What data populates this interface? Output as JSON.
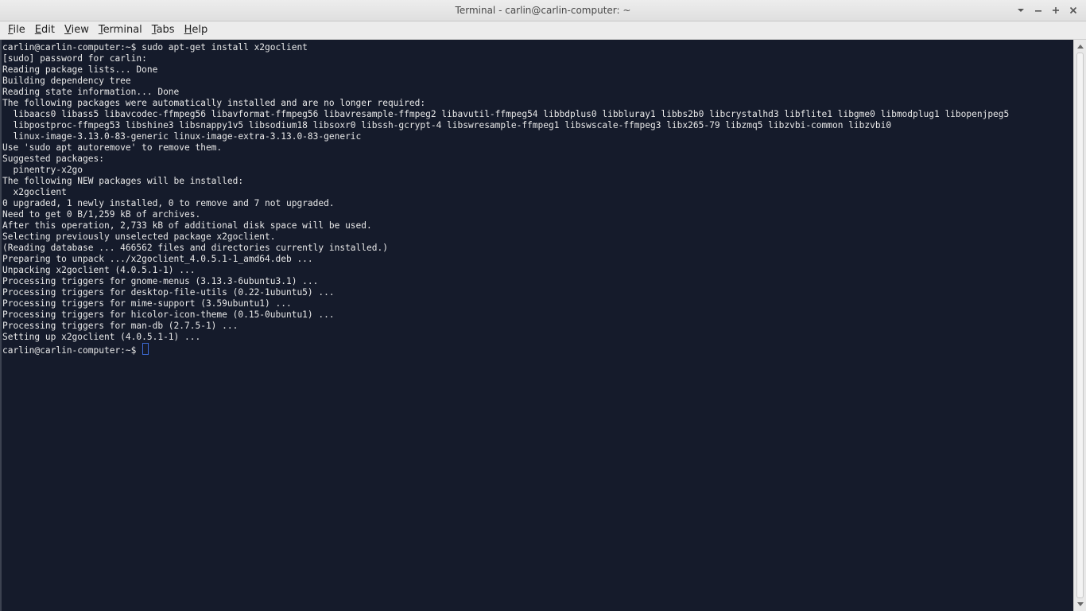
{
  "window": {
    "title": "Terminal - carlin@carlin-computer: ~"
  },
  "controls": {
    "menu_icon": "chevron-down-icon",
    "minimize_icon": "minimize-icon",
    "maximize_icon": "maximize-icon",
    "close_icon": "close-icon"
  },
  "menu": [
    {
      "label": "File",
      "mnemonic": "F",
      "rest": "ile"
    },
    {
      "label": "Edit",
      "mnemonic": "E",
      "rest": "dit"
    },
    {
      "label": "View",
      "mnemonic": "V",
      "rest": "iew"
    },
    {
      "label": "Terminal",
      "mnemonic": "T",
      "rest": "erminal"
    },
    {
      "label": "Tabs",
      "mnemonic": "T",
      "rest": "abs"
    },
    {
      "label": "Help",
      "mnemonic": "H",
      "rest": "elp"
    }
  ],
  "terminal": {
    "lines": [
      "carlin@carlin-computer:~$ sudo apt-get install x2goclient",
      "[sudo] password for carlin:",
      "Reading package lists... Done",
      "Building dependency tree",
      "Reading state information... Done",
      "The following packages were automatically installed and are no longer required:",
      "  libaacs0 libass5 libavcodec-ffmpeg56 libavformat-ffmpeg56 libavresample-ffmpeg2 libavutil-ffmpeg54 libbdplus0 libbluray1 libbs2b0 libcrystalhd3 libflite1 libgme0 libmodplug1 libopenjpeg5",
      "  libpostproc-ffmpeg53 libshine3 libsnappy1v5 libsodium18 libsoxr0 libssh-gcrypt-4 libswresample-ffmpeg1 libswscale-ffmpeg3 libx265-79 libzmq5 libzvbi-common libzvbi0",
      "  linux-image-3.13.0-83-generic linux-image-extra-3.13.0-83-generic",
      "Use 'sudo apt autoremove' to remove them.",
      "Suggested packages:",
      "  pinentry-x2go",
      "The following NEW packages will be installed:",
      "  x2goclient",
      "0 upgraded, 1 newly installed, 0 to remove and 7 not upgraded.",
      "Need to get 0 B/1,259 kB of archives.",
      "After this operation, 2,733 kB of additional disk space will be used.",
      "Selecting previously unselected package x2goclient.",
      "(Reading database ... 466562 files and directories currently installed.)",
      "Preparing to unpack .../x2goclient_4.0.5.1-1_amd64.deb ...",
      "Unpacking x2goclient (4.0.5.1-1) ...",
      "Processing triggers for gnome-menus (3.13.3-6ubuntu3.1) ...",
      "Processing triggers for desktop-file-utils (0.22-1ubuntu5) ...",
      "Processing triggers for mime-support (3.59ubuntu1) ...",
      "Processing triggers for hicolor-icon-theme (0.15-0ubuntu1) ...",
      "Processing triggers for man-db (2.7.5-1) ...",
      "Setting up x2goclient (4.0.5.1-1) ..."
    ],
    "prompt": "carlin@carlin-computer:~$ "
  },
  "colors": {
    "background": "#151b2b",
    "foreground": "#e9e9e9",
    "cursor": "#3d6bd6"
  }
}
